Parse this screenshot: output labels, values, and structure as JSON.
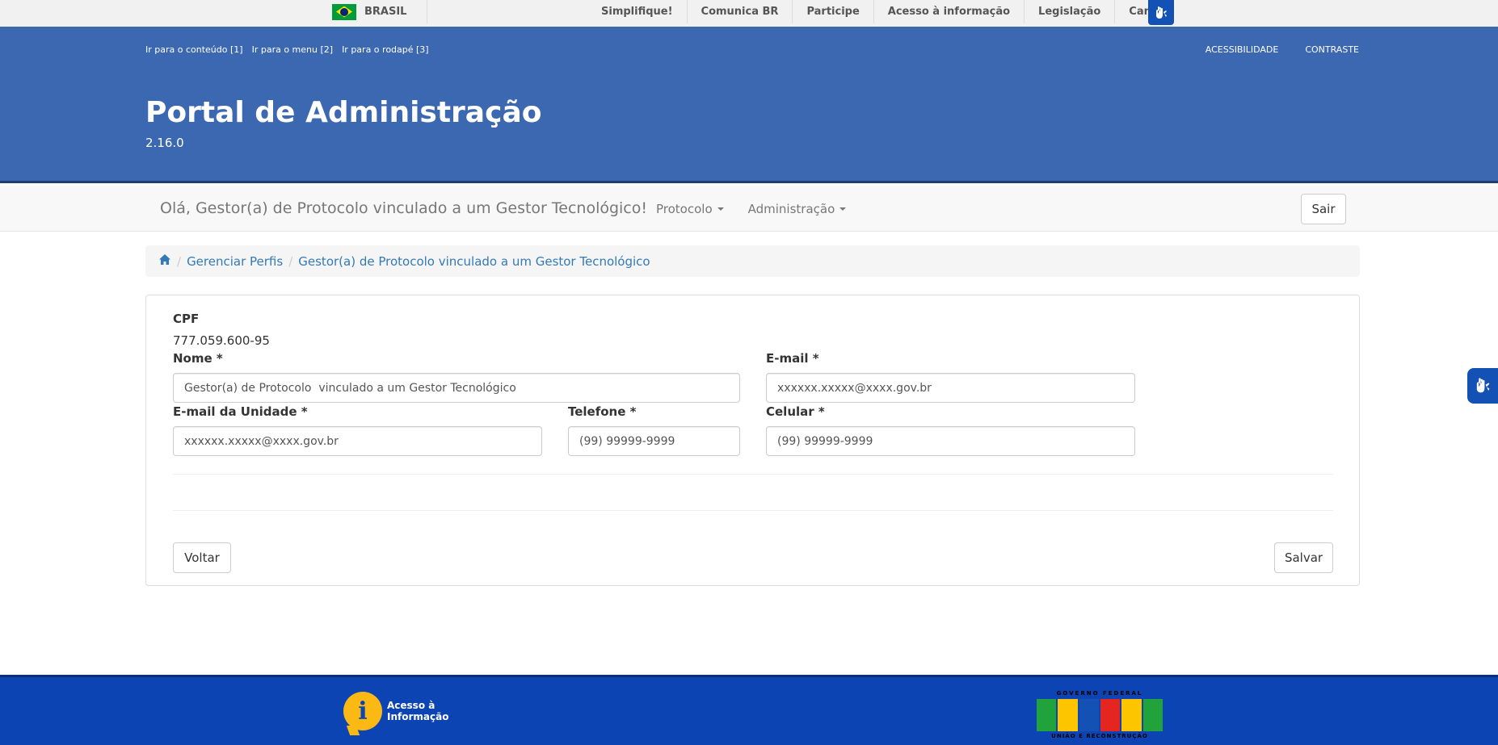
{
  "govbar": {
    "brasil_label": "BRASIL",
    "links": [
      "Simplifique!",
      "Comunica BR",
      "Participe",
      "Acesso à informação",
      "Legislação",
      "Canais"
    ]
  },
  "header": {
    "skip_links": [
      "Ir para o conteúdo [1]",
      "Ir para o menu [2]",
      "Ir para o rodapé [3]"
    ],
    "accessibility": "ACESSIBILIDADE",
    "contrast": "CONTRASTE",
    "title": "Portal de Administração",
    "version": "2.16.0"
  },
  "navbar": {
    "greeting": "Olá, Gestor(a) de Protocolo vinculado a um Gestor Tecnológico!",
    "menu": [
      "Protocolo",
      "Administração"
    ],
    "logout": "Sair"
  },
  "breadcrumb": {
    "items": [
      "Gerenciar Perfis",
      "Gestor(a) de Protocolo vinculado a um Gestor Tecnológico"
    ]
  },
  "form": {
    "cpf_label": "CPF",
    "cpf_value": "777.059.600-95",
    "nome_label": "Nome *",
    "nome_value": "Gestor(a) de Protocolo  vinculado a um Gestor Tecnológico",
    "email_label": "E-mail *",
    "email_value": "xxxxxx.xxxxx@xxxx.gov.br",
    "email_unidade_label": "E-mail da Unidade *",
    "email_unidade_value": "xxxxxx.xxxxx@xxxx.gov.br",
    "telefone_label": "Telefone *",
    "telefone_placeholder": "(99) 99999-9999",
    "celular_label": "Celular *",
    "celular_placeholder": "(99) 99999-9999",
    "back_button": "Voltar",
    "save_button": "Salvar"
  },
  "footer": {
    "acesso_informacao": [
      "Acesso à",
      "Informação"
    ],
    "gov_logo_top": "GOVERNO FEDERAL",
    "gov_logo_word": "BRASIL",
    "gov_logo_bottom": "UNIÃO E RECONSTRUÇÃO"
  },
  "colors": {
    "header_blue": "#3c68b2",
    "footer_blue": "#0c44b4",
    "link_blue": "#337ab7"
  },
  "icons": [
    "brazil-flag-icon",
    "vlibras-hands-icon",
    "home-icon",
    "caret-down-icon",
    "acesso-informacao-logo",
    "gov-brasil-logo"
  ]
}
